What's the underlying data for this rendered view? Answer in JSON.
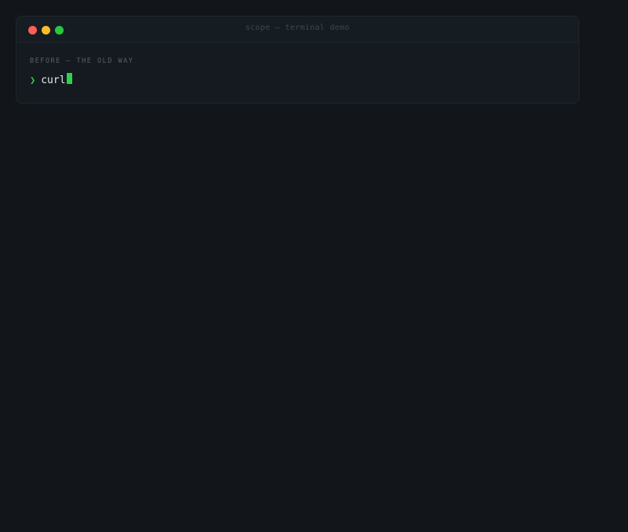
{
  "window": {
    "title": "scope — terminal demo"
  },
  "terminal": {
    "section_label": "BEFORE — THE OLD WAY",
    "prompt_symbol": "❯",
    "command": "curl"
  },
  "colors": {
    "background": "#12161b",
    "close": "#ff5f57",
    "minimize": "#febc2e",
    "maximize": "#28c840",
    "accent": "#2fd24a"
  }
}
